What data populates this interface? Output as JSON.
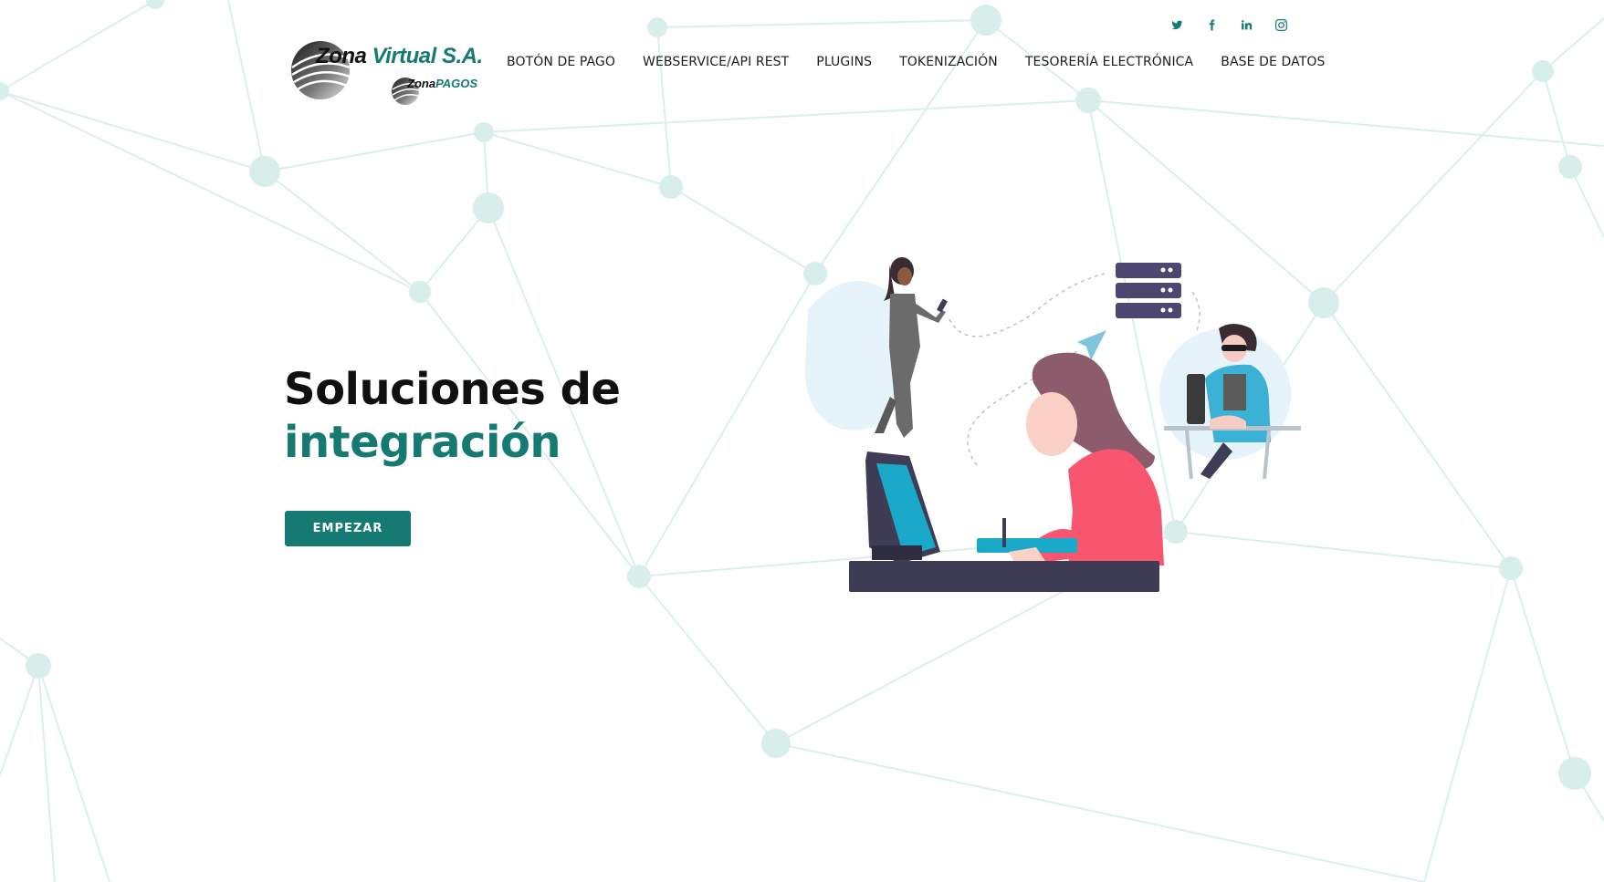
{
  "colors": {
    "accent": "#157a72",
    "network": "#cfeae6",
    "button_text": "#ffffff"
  },
  "social": [
    {
      "name": "twitter-icon"
    },
    {
      "name": "facebook-icon"
    },
    {
      "name": "linkedin-icon"
    },
    {
      "name": "instagram-icon"
    }
  ],
  "logo": {
    "brand_zona": "Zona",
    "brand_virtual": "Virtual S.A.",
    "sub_zona": "Zona",
    "sub_pagos": "PAGOS"
  },
  "nav": {
    "items": [
      {
        "label": "BOTÓN DE PAGO"
      },
      {
        "label": "WEBSERVICE/API REST"
      },
      {
        "label": "PLUGINS"
      },
      {
        "label": "TOKENIZACIÓN"
      },
      {
        "label": "TESORERÍA ELECTRÓNICA"
      },
      {
        "label": "BASE DE DATOS"
      }
    ]
  },
  "hero": {
    "title_line1": "Soluciones de",
    "title_line2": "integración",
    "cta_label": "EMPEZAR"
  }
}
